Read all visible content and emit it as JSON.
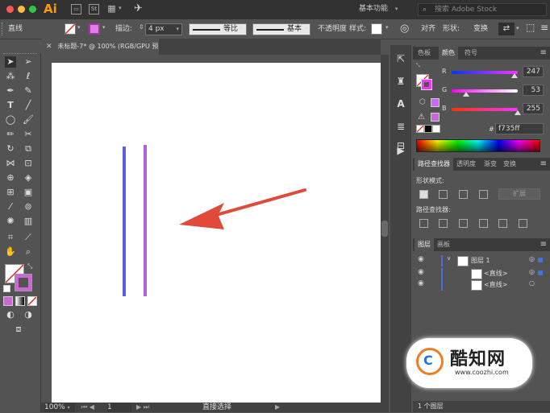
{
  "titlebar": {
    "app_logo": "Ai",
    "st_icon": "St",
    "workspace": "基本功能",
    "search_placeholder": "搜索 Adobe Stock"
  },
  "controlbar": {
    "object_type": "直线",
    "stroke_label": "描边:",
    "stroke_value": "4 px",
    "profile_label": "等比",
    "brush_label": "基本",
    "opacity_label": "不透明度",
    "style_label": "样式:",
    "align_label": "对齐",
    "shape_label": "形状:",
    "transform_label": "变换"
  },
  "document": {
    "tab_title": "未标题-7* @ 100% (RGB/GPU 预览)",
    "zoom": "100%",
    "artboard_num": "1",
    "status_tool": "直接选择"
  },
  "color_panel": {
    "tabs": [
      "色板",
      "颜色",
      "符号"
    ],
    "active_tab": "颜色",
    "r_label": "R",
    "r_value": "247",
    "g_label": "G",
    "g_value": "53",
    "b_label": "B",
    "b_value": "255",
    "hex_label": "#",
    "hex_value": "f735ff",
    "stroke_color": "#f735ff",
    "line1_color": "#5d5fd8",
    "line2_color": "#b060e0",
    "arrow_color": "#e04a3a"
  },
  "pathfinder_panel": {
    "tabs": [
      "路径查找器",
      "透明度",
      "渐变",
      "变换"
    ],
    "shape_modes_label": "形状模式:",
    "expand_button": "扩展",
    "pathfinders_label": "路径查找器:"
  },
  "layers_panel": {
    "tabs": [
      "图层",
      "画板"
    ],
    "layers": [
      {
        "name": "图层 1"
      },
      {
        "name": "<直线>"
      },
      {
        "name": "<直线>"
      }
    ],
    "footer": "1 个图层"
  },
  "watermark": {
    "brand": "酷知网",
    "url": "www.coozhi.com"
  }
}
